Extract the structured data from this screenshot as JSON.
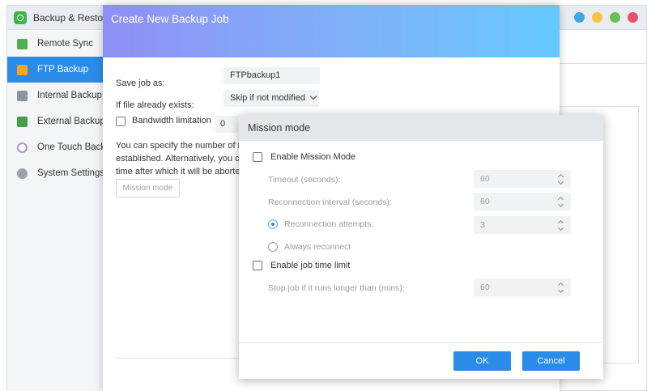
{
  "app": {
    "title": "Backup & Resto",
    "window_dots": [
      "#3fa7e4",
      "#f6c343",
      "#69be54",
      "#e8516b"
    ]
  },
  "sidebar": {
    "items": [
      {
        "label": "Remote Sync",
        "icon": "sync-icon",
        "active": false
      },
      {
        "label": "FTP Backup",
        "icon": "ftp-icon",
        "active": true
      },
      {
        "label": "Internal Backup",
        "icon": "internal-drive-icon",
        "active": false
      },
      {
        "label": "External Backup",
        "icon": "external-drive-icon",
        "active": false
      },
      {
        "label": "One Touch Backup",
        "icon": "one-touch-icon",
        "active": false
      },
      {
        "label": "System Settings",
        "icon": "gear-icon",
        "active": false
      }
    ]
  },
  "job_dialog": {
    "title": "Create New Backup Job",
    "save_job_label": "Save job as:",
    "save_job_value": "FTPbackup1",
    "file_exists_label": "If file already exists:",
    "file_exists_value": "Skip if not modified",
    "bandwidth_label": "Bandwidth limitation",
    "bandwidth_value": "0",
    "bandwidth_checked": false,
    "description_lines": [
      "You can specify the number of re",
      "established. Alternatively, you can",
      "time after which it will be aborted"
    ],
    "mission_mode_button": "Mission mode"
  },
  "mission_dialog": {
    "title": "Mission mode",
    "enable_mission_label": "Enable Mission Mode",
    "enable_mission_checked": false,
    "timeout_label": "Timeout (seconds):",
    "timeout_value": "60",
    "reconnection_interval_label": "Reconnection interval (seconds):",
    "reconnection_interval_value": "60",
    "reconnection_attempts_label": "Reconnection attempts:",
    "reconnection_attempts_value": "3",
    "reconnection_attempts_selected": true,
    "always_reconnect_label": "Always reconnect",
    "always_reconnect_selected": false,
    "enable_time_limit_label": "Enable job time limit",
    "enable_time_limit_checked": false,
    "stop_job_label": "Stop job if it runs longer than (mins):",
    "stop_job_value": "60",
    "ok_label": "OK",
    "cancel_label": "Cancel"
  },
  "colors": {
    "accent": "#2a8be8",
    "header_gradient_start": "#8f8ff5",
    "header_gradient_end": "#66c9fb"
  }
}
